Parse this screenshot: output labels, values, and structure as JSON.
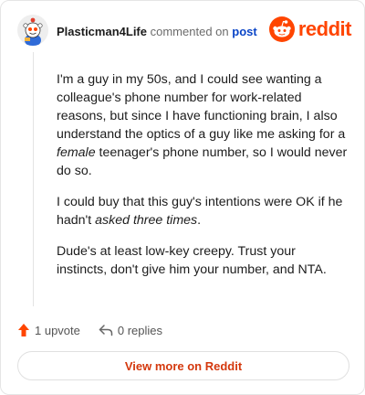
{
  "comment": {
    "author": "Plasticman4Life",
    "action_text": "commented on",
    "target_link": "post",
    "paragraphs": [
      [
        {
          "text": "I'm a guy in my 50s, and I could see wanting a colleague's phone number for work-related reasons, but since I have functioning brain, I also understand the optics of a guy like me asking for a "
        },
        {
          "text": "female",
          "em": true
        },
        {
          "text": " teenager's phone number, so I would never do so."
        }
      ],
      [
        {
          "text": "I could buy that this guy's intentions were OK if he hadn't "
        },
        {
          "text": "asked three times",
          "em": true
        },
        {
          "text": "."
        }
      ],
      [
        {
          "text": "Dude's at least low-key creepy. Trust your instincts, don't give him your number, and NTA."
        }
      ]
    ]
  },
  "brand": {
    "name": "reddit",
    "icon": "reddit-snoo-icon",
    "color": "#ff4500"
  },
  "footer": {
    "upvotes": "1 upvote",
    "replies": "0 replies",
    "view_more": "View more on Reddit"
  }
}
